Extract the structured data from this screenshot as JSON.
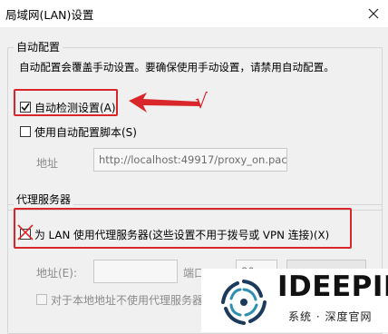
{
  "window": {
    "title": "局域网(LAN)设置"
  },
  "auto_config": {
    "group_label": "自动配置",
    "description": "自动配置会覆盖手动设置。要确保使用手动设置，请禁用自动配置。",
    "auto_detect": {
      "label": "自动检测设置(A)",
      "checked": true
    },
    "use_script": {
      "label": "使用自动配置脚本(S)",
      "checked": false
    },
    "address_label": "地址",
    "address_value": "http://localhost:49917/proxy_on.pac"
  },
  "proxy_server": {
    "group_label": "代理服务器",
    "use_proxy": {
      "label": "为 LAN 使用代理服务器(这些设置不用于拨号或 VPN 连接)(X)",
      "checked": false
    },
    "address_label": "地址(E):",
    "port_label": "端口",
    "port_value": "80",
    "bypass_local": {
      "label": "对于本地地址不使用代理服务器(",
      "checked": false
    }
  },
  "annotation": {
    "checkmark": "√",
    "highlight_color": "#d9262a"
  },
  "watermark": {
    "brand": "IDEEPIN",
    "subtitle": "系统 · 深度官网"
  }
}
